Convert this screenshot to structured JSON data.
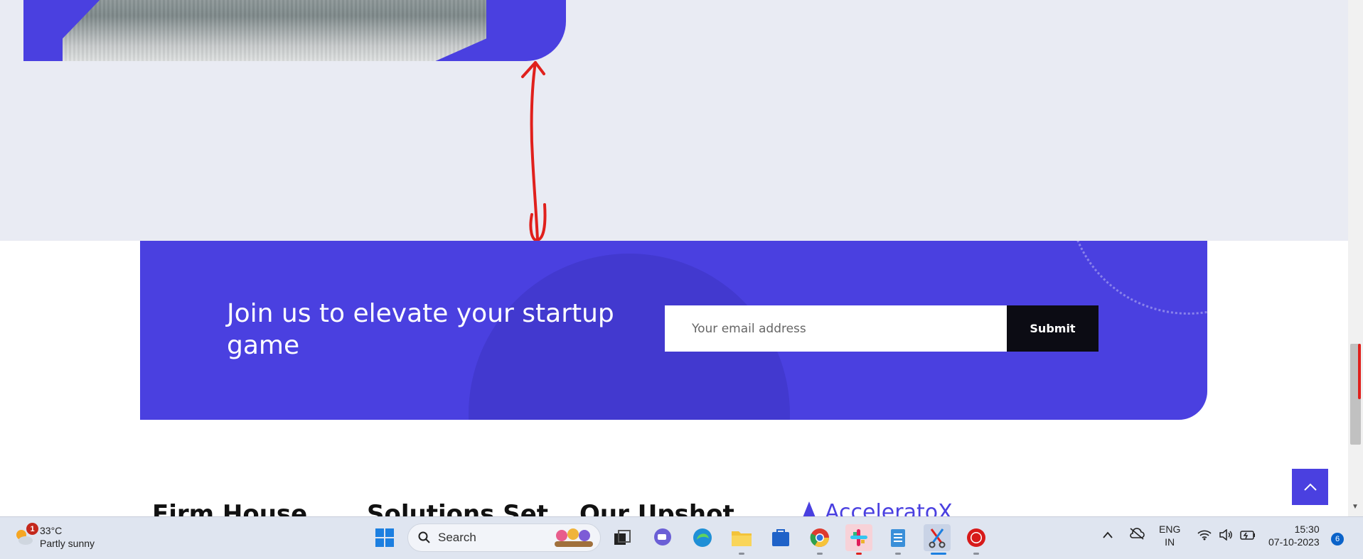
{
  "cta": {
    "title": "Join us to elevate your startup game",
    "email_placeholder": "Your email address",
    "submit_label": "Submit"
  },
  "footer": {
    "headings": [
      "Firm House",
      "Solutions Set",
      "Our Upshot"
    ],
    "logo_text": "AcceleratoX"
  },
  "taskbar": {
    "weather": {
      "badge": "1",
      "temperature": "33°C",
      "condition": "Partly sunny"
    },
    "search_label": "Search",
    "language": {
      "line1": "ENG",
      "line2": "IN"
    },
    "clock": {
      "time": "15:30",
      "date": "07-10-2023"
    },
    "notification_count": "6"
  },
  "colors": {
    "brand": "#4a40e0",
    "page_gray": "#e9ebf3",
    "annotation_red": "#e0201c"
  }
}
